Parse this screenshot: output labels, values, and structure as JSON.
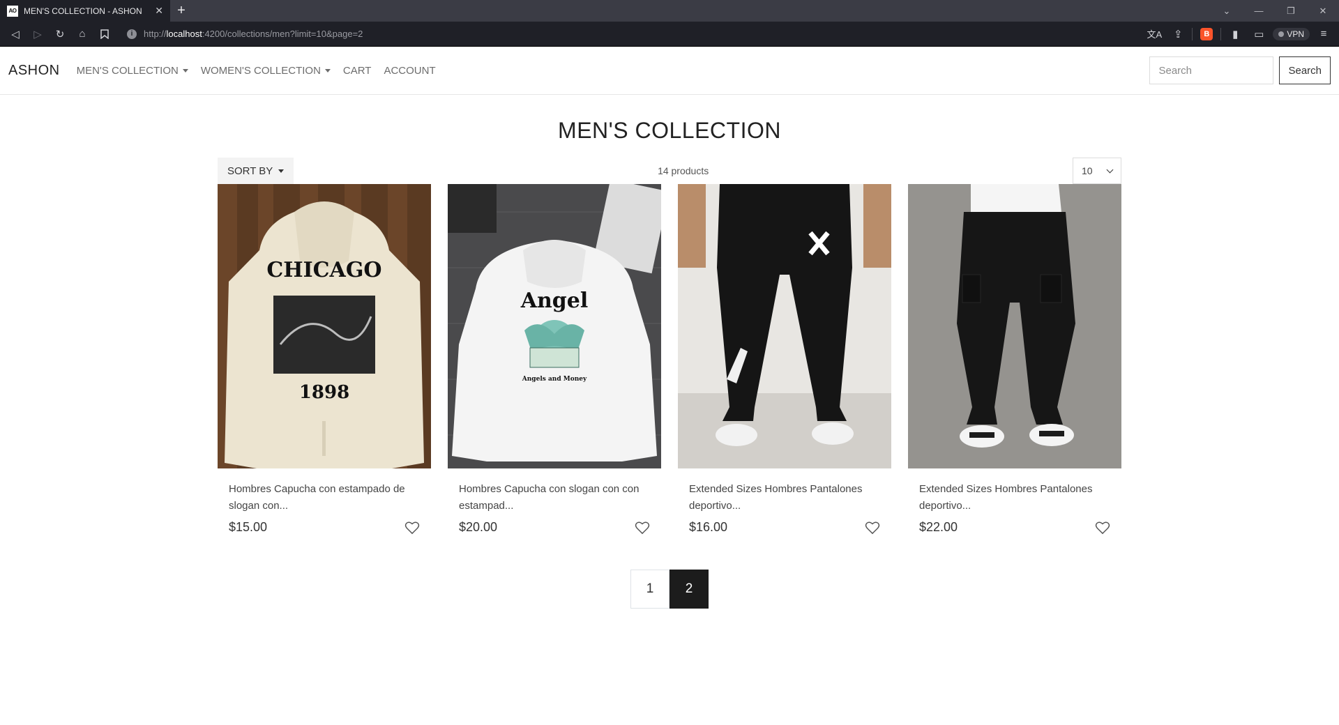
{
  "browser": {
    "tab_title": "MEN'S COLLECTION - ASHON",
    "favicon_text": "AO",
    "url_host": "localhost",
    "url_rest": ":4200/collections/men?limit=10&page=2",
    "url_scheme": "http://",
    "vpn_label": "VPN"
  },
  "nav": {
    "brand": "ASHON",
    "items": [
      {
        "label": "MEN'S COLLECTION",
        "dropdown": true
      },
      {
        "label": "WOMEN'S COLLECTION",
        "dropdown": true
      },
      {
        "label": "CART",
        "dropdown": false
      },
      {
        "label": "ACCOUNT",
        "dropdown": false
      }
    ],
    "search_placeholder": "Search",
    "search_button": "Search"
  },
  "page": {
    "title": "MEN'S COLLECTION",
    "sort_label": "SORT BY",
    "product_count": "14 products",
    "limit_value": "10"
  },
  "products": [
    {
      "title": "Hombres Capucha con estampado de slogan con...",
      "price": "$15.00"
    },
    {
      "title": "Hombres Capucha con slogan con con estampad...",
      "price": "$20.00"
    },
    {
      "title": "Extended Sizes Hombres Pantalones deportivo...",
      "price": "$16.00"
    },
    {
      "title": "Extended Sizes Hombres Pantalones deportivo...",
      "price": "$22.00"
    }
  ],
  "product_image_text": {
    "hoodie1_title": "CHICAGO",
    "hoodie1_year": "1898",
    "hoodie2_title": "Angel",
    "hoodie2_sub": "Angels and Money"
  },
  "pagination": {
    "pages": [
      "1",
      "2"
    ],
    "active": "2"
  }
}
